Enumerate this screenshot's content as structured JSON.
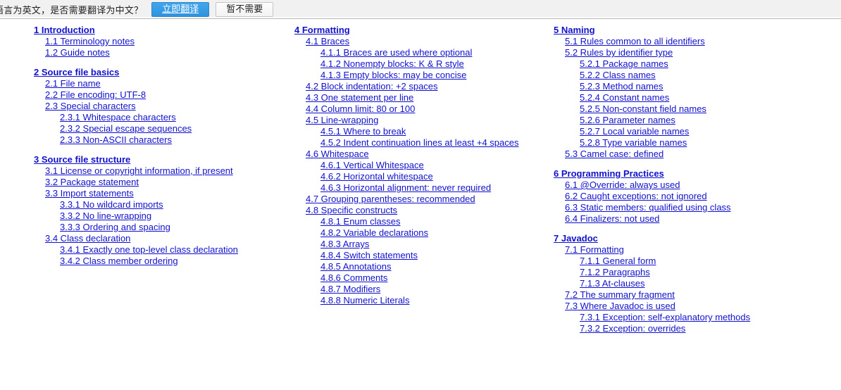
{
  "translate_bar": {
    "message": "语言为英文，是否需要翻译为中文？",
    "translate_button": "立即翻译",
    "dismiss_button": "暂不需要",
    "accent_color": "#2f93dd",
    "bar_background": "#f1f1f1"
  },
  "toc": {
    "link_color": "#1111cc",
    "columns": [
      {
        "name": "column-1",
        "entries": [
          {
            "level": 0,
            "label": "1 Introduction"
          },
          {
            "level": 1,
            "label": "1.1 Terminology notes"
          },
          {
            "level": 1,
            "label": "1.2 Guide notes"
          },
          {
            "level": 0,
            "label": "2 Source file basics"
          },
          {
            "level": 1,
            "label": "2.1 File name"
          },
          {
            "level": 1,
            "label": "2.2 File encoding: UTF-8"
          },
          {
            "level": 1,
            "label": "2.3 Special characters"
          },
          {
            "level": 2,
            "label": "2.3.1 Whitespace characters"
          },
          {
            "level": 2,
            "label": "2.3.2 Special escape sequences"
          },
          {
            "level": 2,
            "label": "2.3.3 Non-ASCII characters"
          },
          {
            "level": 0,
            "label": "3 Source file structure"
          },
          {
            "level": 1,
            "label": "3.1 License or copyright information, if present"
          },
          {
            "level": 1,
            "label": "3.2 Package statement"
          },
          {
            "level": 1,
            "label": "3.3 Import statements"
          },
          {
            "level": 2,
            "label": "3.3.1 No wildcard imports"
          },
          {
            "level": 2,
            "label": "3.3.2 No line-wrapping"
          },
          {
            "level": 2,
            "label": "3.3.3 Ordering and spacing"
          },
          {
            "level": 1,
            "label": "3.4 Class declaration"
          },
          {
            "level": 2,
            "label": "3.4.1 Exactly one top-level class declaration"
          },
          {
            "level": 2,
            "label": "3.4.2 Class member ordering"
          }
        ]
      },
      {
        "name": "column-2",
        "entries": [
          {
            "level": 0,
            "label": "4 Formatting"
          },
          {
            "level": 1,
            "label": "4.1 Braces"
          },
          {
            "level": 2,
            "label": "4.1.1 Braces are used where optional"
          },
          {
            "level": 2,
            "label": "4.1.2 Nonempty blocks: K & R style"
          },
          {
            "level": 2,
            "label": "4.1.3 Empty blocks: may be concise"
          },
          {
            "level": 1,
            "label": "4.2 Block indentation: +2 spaces"
          },
          {
            "level": 1,
            "label": "4.3 One statement per line"
          },
          {
            "level": 1,
            "label": "4.4 Column limit: 80 or 100"
          },
          {
            "level": 1,
            "label": "4.5 Line-wrapping"
          },
          {
            "level": 2,
            "label": "4.5.1 Where to break"
          },
          {
            "level": 2,
            "label": "4.5.2 Indent continuation lines at least +4 spaces"
          },
          {
            "level": 1,
            "label": "4.6 Whitespace"
          },
          {
            "level": 2,
            "label": "4.6.1 Vertical Whitespace"
          },
          {
            "level": 2,
            "label": "4.6.2 Horizontal whitespace"
          },
          {
            "level": 2,
            "label": "4.6.3 Horizontal alignment: never required"
          },
          {
            "level": 1,
            "label": "4.7 Grouping parentheses: recommended"
          },
          {
            "level": 1,
            "label": "4.8 Specific constructs"
          },
          {
            "level": 2,
            "label": "4.8.1 Enum classes"
          },
          {
            "level": 2,
            "label": "4.8.2 Variable declarations"
          },
          {
            "level": 2,
            "label": "4.8.3 Arrays"
          },
          {
            "level": 2,
            "label": "4.8.4 Switch statements"
          },
          {
            "level": 2,
            "label": "4.8.5 Annotations"
          },
          {
            "level": 2,
            "label": "4.8.6 Comments"
          },
          {
            "level": 2,
            "label": "4.8.7 Modifiers"
          },
          {
            "level": 2,
            "label": "4.8.8 Numeric Literals"
          }
        ]
      },
      {
        "name": "column-3",
        "entries": [
          {
            "level": 0,
            "label": "5 Naming"
          },
          {
            "level": 1,
            "label": "5.1 Rules common to all identifiers"
          },
          {
            "level": 1,
            "label": "5.2 Rules by identifier type"
          },
          {
            "level": 2,
            "label": "5.2.1 Package names"
          },
          {
            "level": 2,
            "label": "5.2.2 Class names"
          },
          {
            "level": 2,
            "label": "5.2.3 Method names"
          },
          {
            "level": 2,
            "label": "5.2.4 Constant names"
          },
          {
            "level": 2,
            "label": "5.2.5 Non-constant field names"
          },
          {
            "level": 2,
            "label": "5.2.6 Parameter names"
          },
          {
            "level": 2,
            "label": "5.2.7 Local variable names"
          },
          {
            "level": 2,
            "label": "5.2.8 Type variable names"
          },
          {
            "level": 1,
            "label": "5.3 Camel case: defined"
          },
          {
            "level": 0,
            "label": "6 Programming Practices"
          },
          {
            "level": 1,
            "label": "6.1 @Override: always used"
          },
          {
            "level": 1,
            "label": "6.2 Caught exceptions: not ignored"
          },
          {
            "level": 1,
            "label": "6.3 Static members: qualified using class"
          },
          {
            "level": 1,
            "label": "6.4 Finalizers: not used"
          },
          {
            "level": 0,
            "label": "7 Javadoc"
          },
          {
            "level": 1,
            "label": "7.1 Formatting"
          },
          {
            "level": 2,
            "label": "7.1.1 General form"
          },
          {
            "level": 2,
            "label": "7.1.2 Paragraphs"
          },
          {
            "level": 2,
            "label": "7.1.3 At-clauses"
          },
          {
            "level": 1,
            "label": "7.2 The summary fragment"
          },
          {
            "level": 1,
            "label": "7.3 Where Javadoc is used"
          },
          {
            "level": 2,
            "label": "7.3.1 Exception: self-explanatory methods"
          },
          {
            "level": 2,
            "label": "7.3.2 Exception: overrides"
          }
        ]
      }
    ]
  }
}
